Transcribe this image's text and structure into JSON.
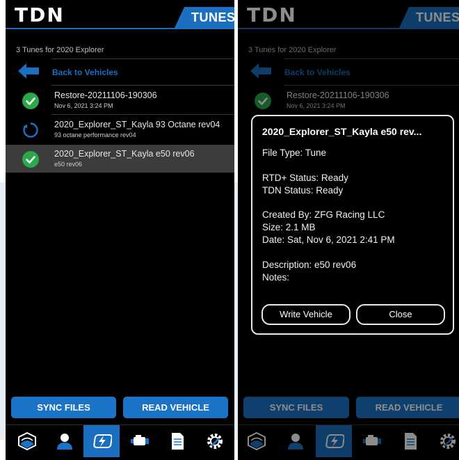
{
  "header": {
    "logo_text": "TDN",
    "tab_label": "TUNES"
  },
  "list": {
    "section_title": "3 Tunes for 2020 Explorer",
    "back_label": "Back to Vehicles",
    "tunes": [
      {
        "name": "Restore-20211106-190306",
        "subtitle": "Nov 6, 2021 3:24 PM",
        "status_icon": "check-circle-icon"
      },
      {
        "name": "2020_Explorer_ST_Kayla 93 Octane rev04",
        "subtitle": "93 octane performance rev04",
        "status_icon": "sync-icon"
      },
      {
        "name": "2020_Explorer_ST_Kayla e50 rev06",
        "subtitle": "e50 rev06",
        "status_icon": "check-circle-icon"
      }
    ]
  },
  "actions": {
    "sync_label": "SYNC FILES",
    "read_label": "READ VEHICLE"
  },
  "tabbar": [
    "vehicle-icon",
    "profile-icon",
    "tunes-icon",
    "engine-icon",
    "document-icon",
    "settings-icon"
  ],
  "dialog": {
    "title": "2020_Explorer_ST_Kayla e50 rev...",
    "file_type": "File Type: Tune",
    "rtd_status": "RTD+ Status: Ready",
    "tdn_status": "TDN Status: Ready",
    "created_by": "Created By: ZFG Racing LLC",
    "size": "Size: 2.1 MB",
    "date": "Date: Sat, Nov 6, 2021 2:41 PM",
    "description": "Description: e50 rev06",
    "notes": "Notes:",
    "write_label": "Write Vehicle",
    "close_label": "Close"
  },
  "colors": {
    "accent": "#1a6fc0",
    "success": "#2aa84a",
    "background": "#000000"
  }
}
